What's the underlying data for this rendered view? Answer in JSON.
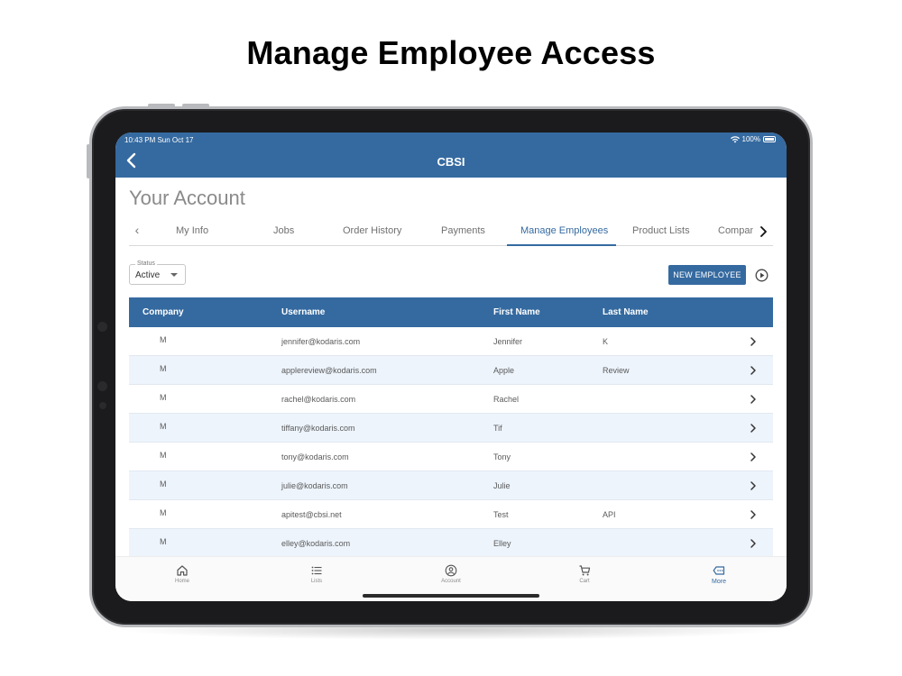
{
  "headline": "Manage Employee Access",
  "status_bar": {
    "time": "10:43 PM  Sun Oct 17",
    "battery": "100%"
  },
  "app_bar": {
    "title": "CBSI"
  },
  "page_title": "Your Account",
  "tabs": [
    {
      "label": "My Info"
    },
    {
      "label": "Jobs"
    },
    {
      "label": "Order History"
    },
    {
      "label": "Payments"
    },
    {
      "label": "Manage Employees",
      "active": true
    },
    {
      "label": "Product Lists"
    },
    {
      "label": "Company"
    }
  ],
  "filter": {
    "label": "Status",
    "value": "Active"
  },
  "new_employee_label": "NEW EMPLOYEE",
  "table": {
    "headers": [
      "Company",
      "Username",
      "First Name",
      "Last Name"
    ],
    "rows": [
      {
        "company": "M",
        "username": "jennifer@kodaris.com",
        "first": "Jennifer",
        "last": "K"
      },
      {
        "company": "M",
        "username": "applereview@kodaris.com",
        "first": "Apple",
        "last": "Review"
      },
      {
        "company": "M",
        "username": "rachel@kodaris.com",
        "first": "Rachel",
        "last": ""
      },
      {
        "company": "M",
        "username": "tiffany@kodaris.com",
        "first": "Tif",
        "last": ""
      },
      {
        "company": "M",
        "username": "tony@kodaris.com",
        "first": "Tony",
        "last": ""
      },
      {
        "company": "M",
        "username": "julie@kodaris.com",
        "first": "Julie",
        "last": ""
      },
      {
        "company": "M",
        "username": "apitest@cbsi.net",
        "first": "Test",
        "last": "API"
      },
      {
        "company": "M",
        "username": "elley@kodaris.com",
        "first": "Elley",
        "last": ""
      }
    ]
  },
  "bottom_nav": [
    {
      "label": "Home",
      "icon": "home-icon"
    },
    {
      "label": "Lists",
      "icon": "list-icon"
    },
    {
      "label": "Account",
      "icon": "account-icon"
    },
    {
      "label": "Cart",
      "icon": "cart-icon"
    },
    {
      "label": "More",
      "icon": "more-icon",
      "active": true
    }
  ],
  "colors": {
    "primary": "#356aa0",
    "row_alt": "#edf4fc"
  }
}
